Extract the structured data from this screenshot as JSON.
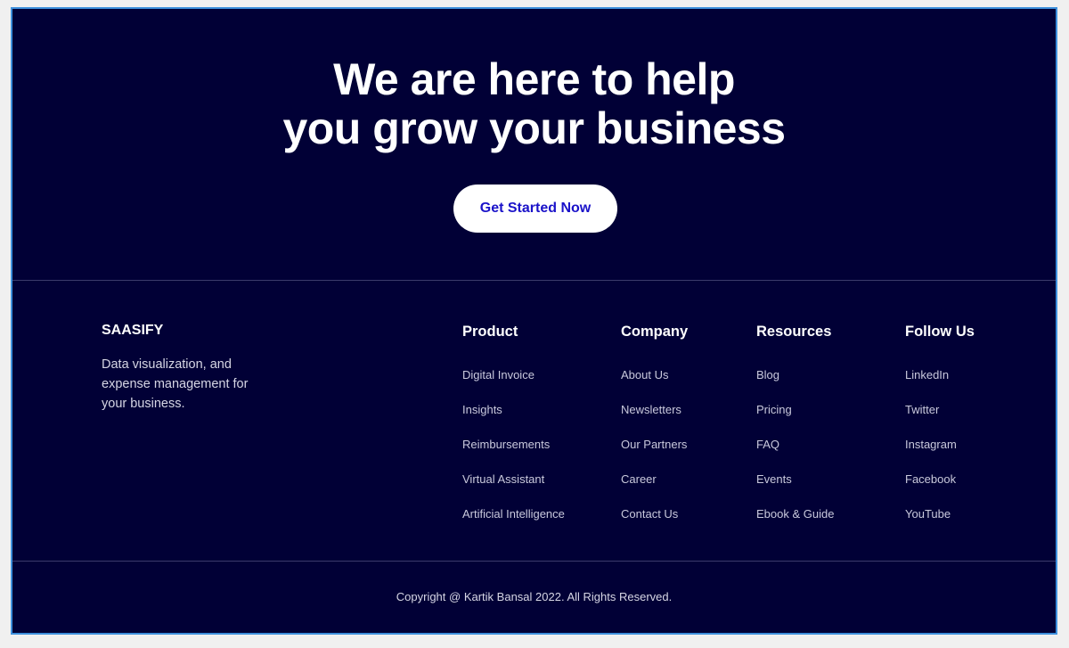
{
  "hero": {
    "headline_line1": "We are here to help",
    "headline_line2": "you grow your business",
    "cta_label": "Get Started Now"
  },
  "brand": {
    "name": "SAASIFY",
    "tagline": "Data visualization, and expense management for your business."
  },
  "columns": [
    {
      "title": "Product",
      "links": [
        "Digital Invoice",
        "Insights",
        "Reimbursements",
        "Virtual Assistant",
        "Artificial Intelligence"
      ]
    },
    {
      "title": "Company",
      "links": [
        "About Us",
        "Newsletters",
        "Our Partners",
        "Career",
        "Contact Us"
      ]
    },
    {
      "title": "Resources",
      "links": [
        "Blog",
        "Pricing",
        "FAQ",
        "Events",
        "Ebook & Guide"
      ]
    },
    {
      "title": "Follow Us",
      "links": [
        "LinkedIn",
        "Twitter",
        "Instagram",
        "Facebook",
        "YouTube"
      ]
    }
  ],
  "footer": {
    "copyright": "Copyright @ Kartik Bansal 2022. All Rights Reserved."
  },
  "colors": {
    "background": "#010036",
    "cta_text": "#1a12c9",
    "frame_border": "#3d8fdc"
  }
}
